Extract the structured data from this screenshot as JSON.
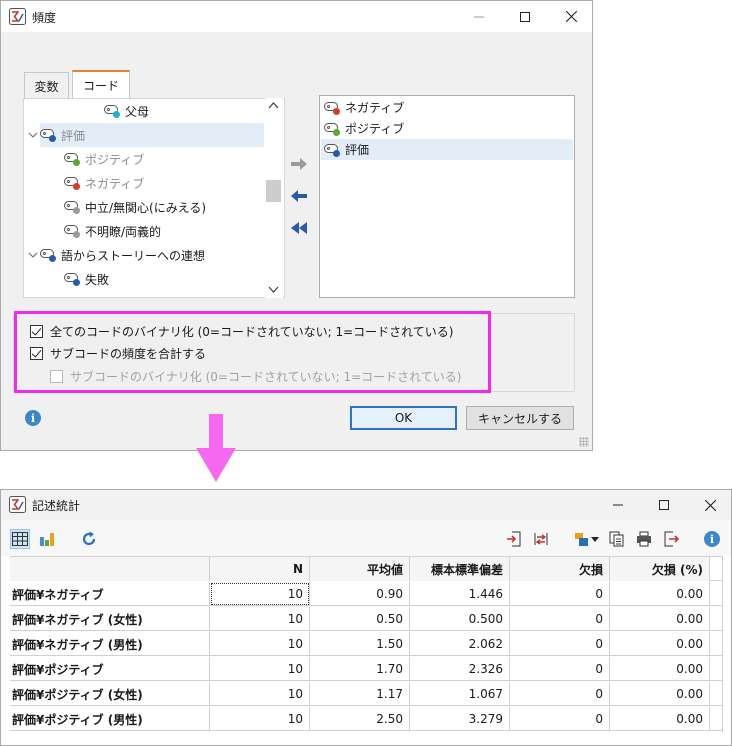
{
  "dialog": {
    "title": "頻度",
    "tabs": [
      {
        "label": "変数",
        "active": false
      },
      {
        "label": "コード",
        "active": true
      }
    ],
    "tree_items": [
      {
        "label": "父母",
        "dot_color": "#20b0c8",
        "dim": false,
        "group": false
      },
      {
        "label": "評価",
        "dot_color": "#2a5aa8",
        "dim": true,
        "group": true,
        "selected": true
      },
      {
        "label": "ポジティブ",
        "dot_color": "#5aa832",
        "dim": true,
        "group": false
      },
      {
        "label": "ネガティブ",
        "dot_color": "#d63a2a",
        "dim": true,
        "group": false
      },
      {
        "label": "中立/無関心(にみえる)",
        "dot_color": "#9a9a9a",
        "dim": false,
        "group": false
      },
      {
        "label": "不明瞭/両義的",
        "dot_color": "#9a9a9a",
        "dim": false,
        "group": false
      },
      {
        "label": "語からストーリーへの連想",
        "dot_color": "#2a5aa8",
        "dim": false,
        "group": true
      },
      {
        "label": "失敗",
        "dot_color": "#2a5aa8",
        "dim": false,
        "group": false
      }
    ],
    "selected_codes": [
      {
        "label": "ネガティブ",
        "dot_color": "#d63a2a",
        "selected": false
      },
      {
        "label": "ポジティブ",
        "dot_color": "#5aa832",
        "selected": false
      },
      {
        "label": "評価",
        "dot_color": "#2a5aa8",
        "selected": true
      }
    ],
    "options": [
      {
        "label": "全てのコードのバイナリ化 (0=コードされていない; 1=コードされている)",
        "checked": true,
        "enabled": true
      },
      {
        "label": "サブコードの頻度を合計する",
        "checked": true,
        "enabled": true
      },
      {
        "label": "サブコードのバイナリ化 (0=コードされていない; 1=コードされている)",
        "checked": false,
        "enabled": false
      }
    ],
    "ok_label": "OK",
    "cancel_label": "キャンセルする",
    "highlight_color": "#f02bf0"
  },
  "stats_window": {
    "title": "記述統計",
    "columns": [
      "",
      "N",
      "平均値",
      "標本標準偏差",
      "欠損",
      "欠損 (%)"
    ],
    "rows": [
      [
        "評価¥ネガティブ",
        "10",
        "0.90",
        "1.446",
        "0",
        "0.00"
      ],
      [
        "評価¥ネガティブ (女性)",
        "10",
        "0.50",
        "0.500",
        "0",
        "0.00"
      ],
      [
        "評価¥ネガティブ (男性)",
        "10",
        "1.50",
        "2.062",
        "0",
        "0.00"
      ],
      [
        "評価¥ポジティブ",
        "10",
        "1.70",
        "2.326",
        "0",
        "0.00"
      ],
      [
        "評価¥ポジティブ (女性)",
        "10",
        "1.17",
        "1.067",
        "0",
        "0.00"
      ],
      [
        "評価¥ポジティブ (男性)",
        "10",
        "2.50",
        "3.279",
        "0",
        "0.00"
      ]
    ]
  }
}
